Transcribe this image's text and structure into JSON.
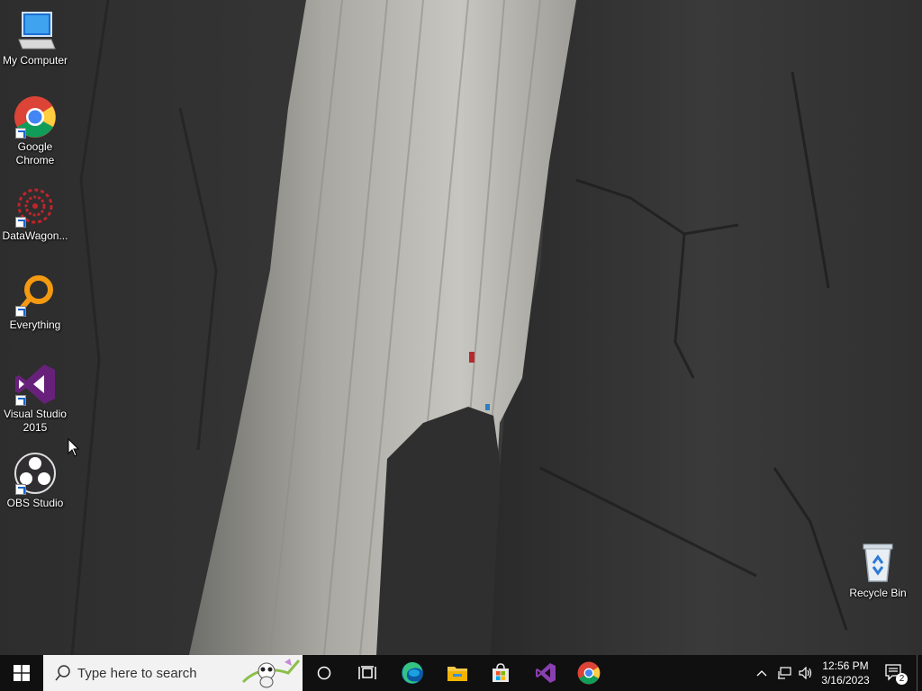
{
  "desktop": {
    "icons": [
      {
        "label": "My Computer",
        "icon": "computer-icon"
      },
      {
        "label": "Google Chrome",
        "icon": "chrome-icon"
      },
      {
        "label": "DataWagon...",
        "icon": "datawagon-icon"
      },
      {
        "label": "Everything",
        "icon": "everything-search-icon"
      },
      {
        "label": "Visual Studio 2015",
        "icon": "visual-studio-icon"
      },
      {
        "label": "OBS Studio",
        "icon": "obs-icon"
      },
      {
        "label": "Recycle Bin",
        "icon": "recycle-bin-icon"
      }
    ]
  },
  "taskbar": {
    "search_placeholder": "Type here to search",
    "pinned": [
      "cortana-icon",
      "task-view-icon",
      "edge-icon",
      "file-explorer-icon",
      "microsoft-store-icon",
      "visual-studio-icon",
      "chrome-icon"
    ],
    "clock_time": "12:56 PM",
    "clock_date": "3/16/2023",
    "notification_count": "2"
  },
  "colors": {
    "taskbar_bg": "#101010",
    "search_bg": "#f2f2f2",
    "accent_blue": "#0078d7"
  }
}
